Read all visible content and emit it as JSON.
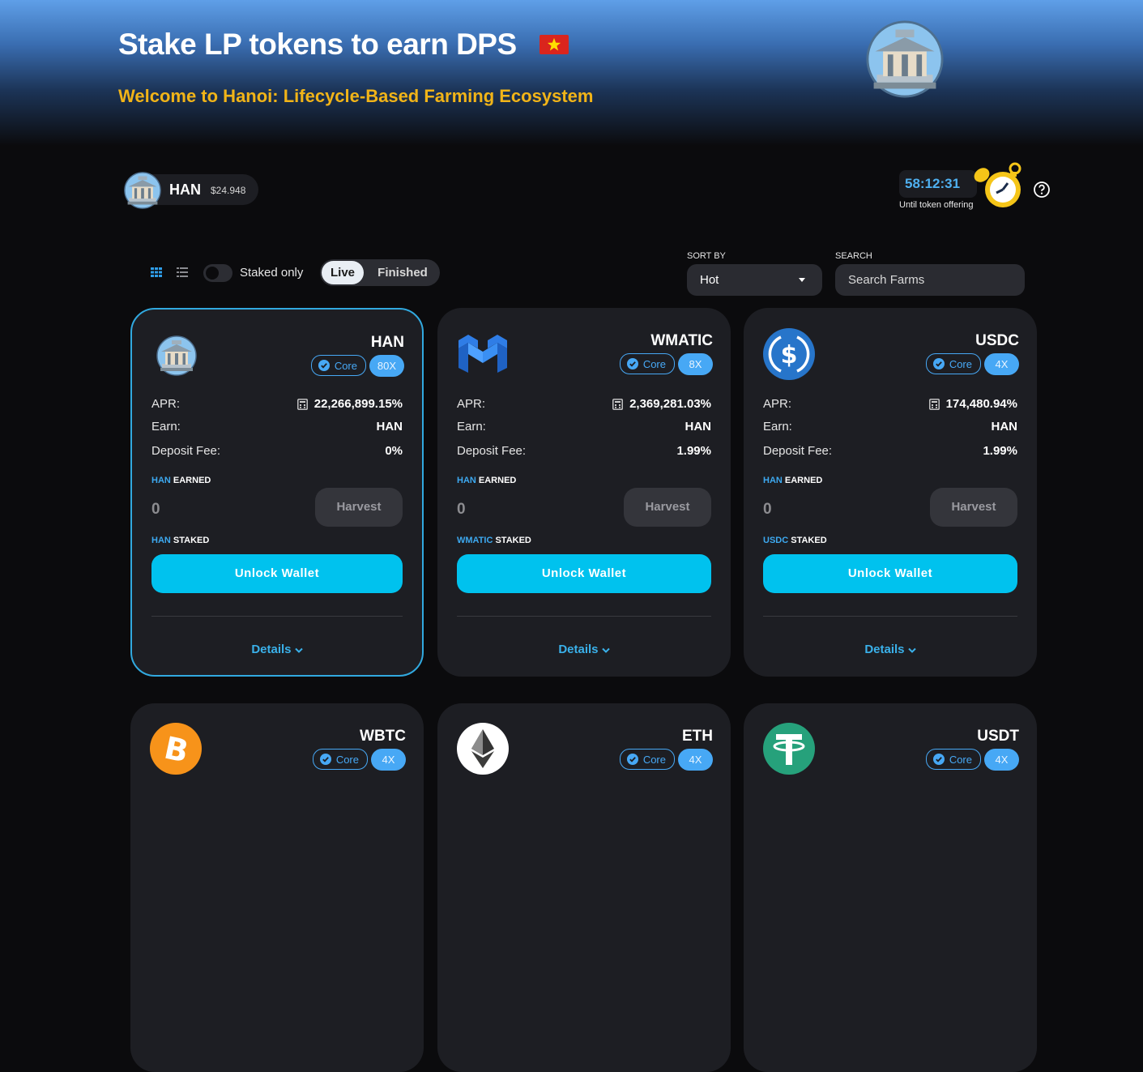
{
  "hero": {
    "title": "Stake LP tokens to earn DPS",
    "subtitle": "Welcome to Hanoi: Lifecycle-Based Farming Ecosystem"
  },
  "token": {
    "name": "HAN",
    "price": "$24.948"
  },
  "countdown": {
    "time": "58:12:31",
    "label": "Until token offering"
  },
  "filters": {
    "staked_only_label": "Staked only",
    "staked_only": false,
    "tabs": [
      "Live",
      "Finished"
    ],
    "active_tab": "Live",
    "sort_label": "SORT BY",
    "sort_value": "Hot",
    "search_label": "SEARCH",
    "search_placeholder": "Search Farms"
  },
  "colors": {
    "accent": "#00c2ee",
    "badge": "#47a8f5",
    "title_gold": "#f1b418",
    "card_bg": "#1d1e23"
  },
  "common": {
    "apr_label": "APR:",
    "earn_label": "Earn:",
    "fee_label": "Deposit Fee:",
    "earned_suffix": "EARNED",
    "staked_suffix": "STAKED",
    "harvest_label": "Harvest",
    "unlock_label": "Unlock Wallet",
    "details_label": "Details",
    "core_label": "Core"
  },
  "farms": [
    {
      "name": "HAN",
      "icon": "temple-icon",
      "multiplier": "80X",
      "apr": "22,266,899.15%",
      "earn": "HAN",
      "fee": "0%",
      "earned_token": "HAN",
      "earned": "0",
      "staked_token": "HAN"
    },
    {
      "name": "WMATIC",
      "icon": "polygon-icon",
      "multiplier": "8X",
      "apr": "2,369,281.03%",
      "earn": "HAN",
      "fee": "1.99%",
      "earned_token": "HAN",
      "earned": "0",
      "staked_token": "WMATIC"
    },
    {
      "name": "USDC",
      "icon": "usdc-icon",
      "multiplier": "4X",
      "apr": "174,480.94%",
      "earn": "HAN",
      "fee": "1.99%",
      "earned_token": "HAN",
      "earned": "0",
      "staked_token": "USDC"
    },
    {
      "name": "WBTC",
      "icon": "bitcoin-icon",
      "multiplier": "4X"
    },
    {
      "name": "ETH",
      "icon": "ethereum-icon",
      "multiplier": "4X"
    },
    {
      "name": "USDT",
      "icon": "tether-icon",
      "multiplier": "4X"
    }
  ]
}
